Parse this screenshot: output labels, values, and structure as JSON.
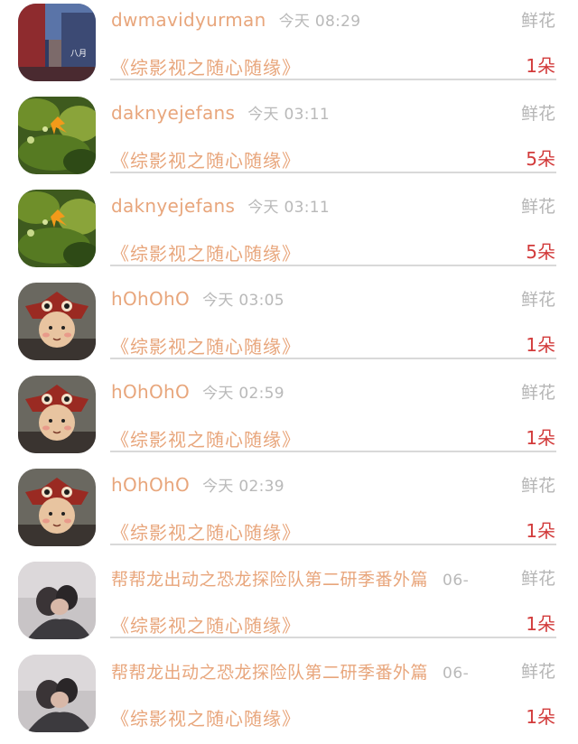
{
  "rows": [
    {
      "name": "dwmavidyurman",
      "time": "今天 08:29",
      "gift": "鲜花",
      "novel": "《综影视之随心随缘》",
      "count": "1朵",
      "avatar": "city-alley-icon"
    },
    {
      "name": "daknyejefans",
      "time": "今天 03:11",
      "gift": "鲜花",
      "novel": "《综影视之随心随缘》",
      "count": "5朵",
      "avatar": "leaf-moss-icon"
    },
    {
      "name": "daknyejefans",
      "time": "今天 03:11",
      "gift": "鲜花",
      "novel": "《综影视之随心随缘》",
      "count": "5朵",
      "avatar": "leaf-moss-icon"
    },
    {
      "name": "hOhOhO",
      "time": "今天 03:05",
      "gift": "鲜花",
      "novel": "《综影视之随心随缘》",
      "count": "1朵",
      "avatar": "cartoon-hat-icon"
    },
    {
      "name": "hOhOhO",
      "time": "今天 02:59",
      "gift": "鲜花",
      "novel": "《综影视之随心随缘》",
      "count": "1朵",
      "avatar": "cartoon-hat-icon"
    },
    {
      "name": "hOhOhO",
      "time": "今天 02:39",
      "gift": "鲜花",
      "novel": "《综影视之随心随缘》",
      "count": "1朵",
      "avatar": "cartoon-hat-icon"
    },
    {
      "name": "帮帮龙出动之恐龙探险队第二研季番外篇",
      "time": "06-",
      "gift": "鲜花",
      "novel": "《综影视之随心随缘》",
      "count": "1朵",
      "avatar": "couple-photo-icon"
    },
    {
      "name": "帮帮龙出动之恐龙探险队第二研季番外篇",
      "time": "06-",
      "gift": "鲜花",
      "novel": "《综影视之随心随缘》",
      "count": "1朵",
      "avatar": "couple-photo-icon"
    }
  ],
  "colors": {
    "accent": "#e8a67c",
    "count": "#d23a3a",
    "muted": "#b5b5b5",
    "divider": "#d9d9d9"
  }
}
